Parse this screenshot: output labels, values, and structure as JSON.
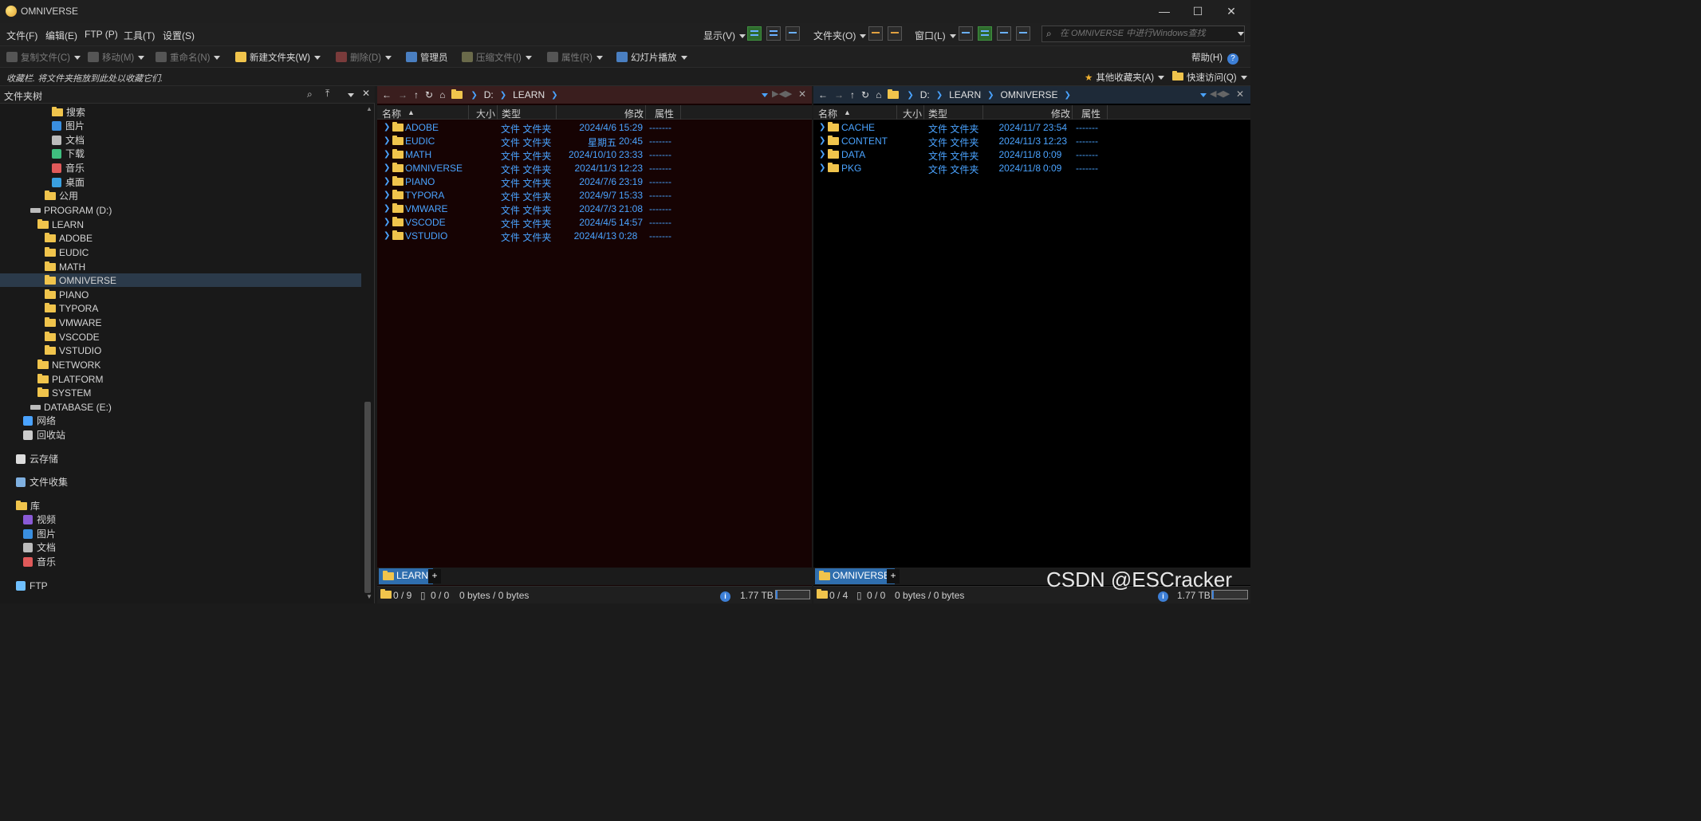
{
  "window": {
    "title": "OMNIVERSE",
    "minimize": "—",
    "maximize": "☐",
    "close": "✕"
  },
  "menu": {
    "file": "文件(F)",
    "edit": "编辑(E)",
    "ftp": "FTP (P)",
    "tools": "工具(T)",
    "settings": "设置(S)",
    "display": "显示(V)",
    "folder": "文件夹(O)",
    "window": "窗口(L)"
  },
  "search": {
    "placeholder": "在 OMNIVERSE 中进行Windows查找"
  },
  "toolbar": {
    "copy_file": "复制文件(C)",
    "move": "移动(M)",
    "rename": "重命名(N)",
    "new_folder": "新建文件夹(W)",
    "delete": "删除(D)",
    "admin": "管理员",
    "compress": "压缩文件(I)",
    "properties": "属性(R)",
    "slideshow": "幻灯片播放",
    "help": "帮助(H)"
  },
  "favorites": {
    "hint": "收藏栏. 将文件夹拖放到此处以收藏它们.",
    "other": "其他收藏夹(A)",
    "quick": "快速访问(Q)"
  },
  "tree": {
    "title": "文件夹树",
    "items": [
      {
        "label": "搜索",
        "icon": "folder"
      },
      {
        "label": "图片",
        "icon": "pictures-icon"
      },
      {
        "label": "文档",
        "icon": "documents-icon"
      },
      {
        "label": "下载",
        "icon": "download-icon"
      },
      {
        "label": "音乐",
        "icon": "music-icon"
      },
      {
        "label": "桌面",
        "icon": "desktop-icon"
      },
      {
        "label": "公用",
        "icon": "folder"
      },
      {
        "label": "PROGRAM (D:)",
        "icon": "drive-icon"
      },
      {
        "label": "LEARN",
        "icon": "folder"
      },
      {
        "label": "ADOBE",
        "icon": "folder"
      },
      {
        "label": "EUDIC",
        "icon": "folder"
      },
      {
        "label": "MATH",
        "icon": "folder"
      },
      {
        "label": "OMNIVERSE",
        "icon": "folder"
      },
      {
        "label": "PIANO",
        "icon": "folder"
      },
      {
        "label": "TYPORA",
        "icon": "folder"
      },
      {
        "label": "VMWARE",
        "icon": "folder"
      },
      {
        "label": "VSCODE",
        "icon": "folder"
      },
      {
        "label": "VSTUDIO",
        "icon": "folder"
      },
      {
        "label": "NETWORK",
        "icon": "folder"
      },
      {
        "label": "PLATFORM",
        "icon": "folder"
      },
      {
        "label": "SYSTEM",
        "icon": "folder"
      },
      {
        "label": "DATABASE (E:)",
        "icon": "drive-icon"
      },
      {
        "label": "网络",
        "icon": "network-icon"
      },
      {
        "label": "回收站",
        "icon": "recycle-bin-icon"
      },
      {
        "label": "云存储",
        "icon": "cloud-icon"
      },
      {
        "label": "文件收集",
        "icon": "collection-icon"
      },
      {
        "label": "库",
        "icon": "folder"
      },
      {
        "label": "视频",
        "icon": "video-icon"
      },
      {
        "label": "图片",
        "icon": "pictures-icon"
      },
      {
        "label": "文档",
        "icon": "documents-icon"
      },
      {
        "label": "音乐",
        "icon": "music-icon"
      },
      {
        "label": "FTP",
        "icon": "ftp-icon"
      }
    ]
  },
  "left_pane": {
    "path": [
      "D:",
      "LEARN"
    ],
    "columns": {
      "name": "名称",
      "size": "大小",
      "type": "类型",
      "modified": "修改",
      "attr": "属性"
    },
    "rows": [
      {
        "name": "ADOBE",
        "type": "文件 文件夹",
        "date": "2024/4/6",
        "time": "15:29",
        "attr": "-------"
      },
      {
        "name": "EUDIC",
        "type": "文件 文件夹",
        "date": "星期五",
        "time": "20:45",
        "attr": "-------"
      },
      {
        "name": "MATH",
        "type": "文件 文件夹",
        "date": "2024/10/10",
        "time": "23:33",
        "attr": "-------"
      },
      {
        "name": "OMNIVERSE",
        "type": "文件 文件夹",
        "date": "2024/11/3",
        "time": "12:23",
        "attr": "-------"
      },
      {
        "name": "PIANO",
        "type": "文件 文件夹",
        "date": "2024/7/6",
        "time": "23:19",
        "attr": "-------"
      },
      {
        "name": "TYPORA",
        "type": "文件 文件夹",
        "date": "2024/9/7",
        "time": "15:33",
        "attr": "-------"
      },
      {
        "name": "VMWARE",
        "type": "文件 文件夹",
        "date": "2024/7/3",
        "time": "21:08",
        "attr": "-------"
      },
      {
        "name": "VSCODE",
        "type": "文件 文件夹",
        "date": "2024/4/5",
        "time": "14:57",
        "attr": "-------"
      },
      {
        "name": "VSTUDIO",
        "type": "文件 文件夹",
        "date": "2024/4/13",
        "time": "0:28",
        "attr": "-------"
      }
    ],
    "tab": "LEARN",
    "status": {
      "folders": "0 / 9",
      "files": "0 / 0",
      "bytes": "0 bytes / 0 bytes",
      "disk": "1.77 TB",
      "disk_used": 0.05
    }
  },
  "right_pane": {
    "path": [
      "D:",
      "LEARN",
      "OMNIVERSE"
    ],
    "columns": {
      "name": "名称",
      "size": "大小",
      "type": "类型",
      "modified": "修改",
      "attr": "属性"
    },
    "rows": [
      {
        "name": "CACHE",
        "type": "文件 文件夹",
        "date": "2024/11/7",
        "time": "23:54",
        "attr": "-------"
      },
      {
        "name": "CONTENT",
        "type": "文件 文件夹",
        "date": "2024/11/3",
        "time": "12:23",
        "attr": "-------"
      },
      {
        "name": "DATA",
        "type": "文件 文件夹",
        "date": "2024/11/8",
        "time": "0:09",
        "attr": "-------"
      },
      {
        "name": "PKG",
        "type": "文件 文件夹",
        "date": "2024/11/8",
        "time": "0:09",
        "attr": "-------"
      }
    ],
    "tab": "OMNIVERSE",
    "status": {
      "folders": "0 / 4",
      "files": "0 / 0",
      "bytes": "0 bytes / 0 bytes",
      "disk": "1.77 TB",
      "disk_used": 0.05
    }
  },
  "watermark": "CSDN @ESCracker",
  "colors": {
    "accent": "#4aa3ff",
    "left_pane_bg": "#160303",
    "right_pane_bg": "#000000",
    "tab": "#2f6eae",
    "selection": "#2b3a4a"
  }
}
